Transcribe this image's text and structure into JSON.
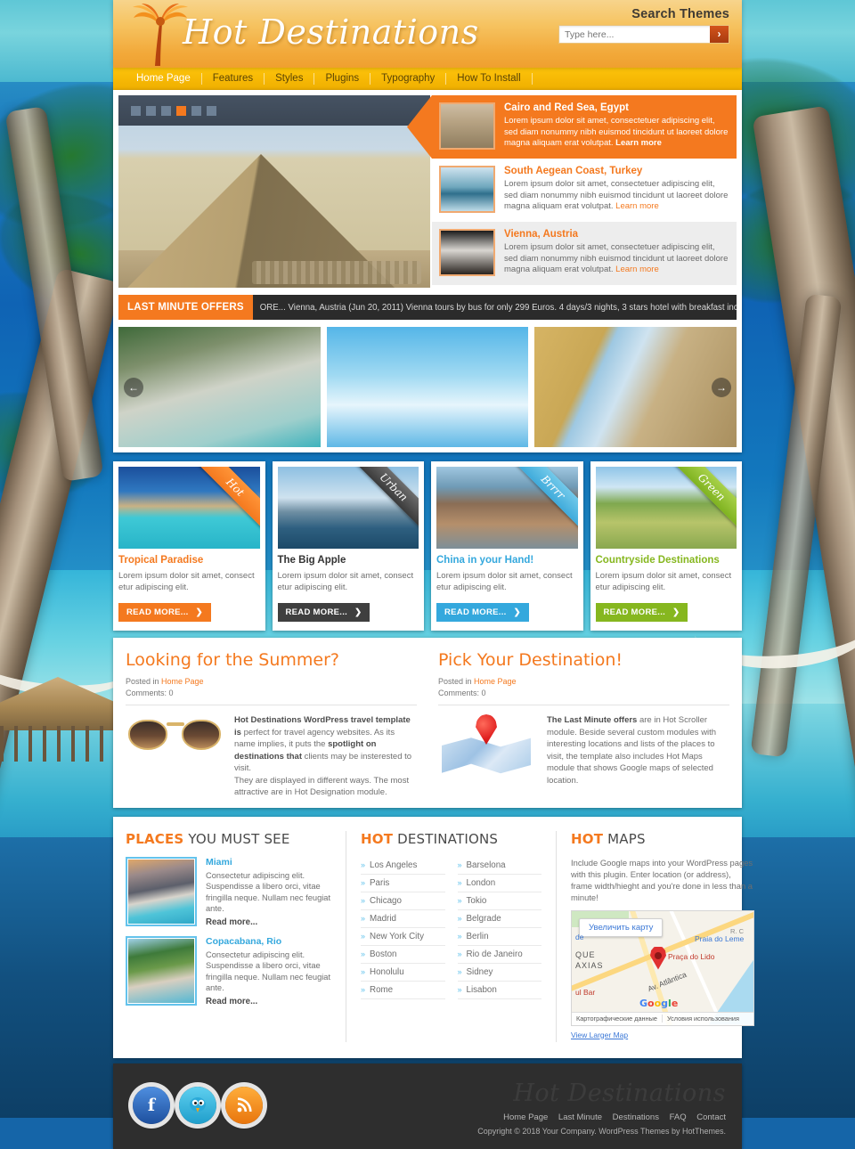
{
  "header": {
    "logo_text": "Hot Destinations",
    "palm_icon": "palm-tree-icon",
    "search_label": "Search Themes",
    "search_placeholder": "Type here...",
    "search_button_icon": "chevron-right-icon"
  },
  "nav": {
    "items": [
      {
        "label": "Home Page",
        "active": true
      },
      {
        "label": "Features",
        "active": false
      },
      {
        "label": "Styles",
        "active": false
      },
      {
        "label": "Plugins",
        "active": false
      },
      {
        "label": "Typography",
        "active": false
      },
      {
        "label": "How To Install",
        "active": false
      }
    ]
  },
  "slider": {
    "dots": [
      false,
      false,
      false,
      true,
      false,
      false
    ],
    "main_image_alt": "pyramid-of-giza-photo",
    "items": [
      {
        "title": "Cairo and Red Sea, Egypt",
        "desc": "Lorem ipsum dolor sit amet, consectetuer adipiscing elit, sed diam nonummy nibh euismod tincidunt ut laoreet dolore magna aliquam erat volutpat.",
        "more": "Learn more",
        "thumb": "egypt-temple-thumb"
      },
      {
        "title": "South Aegean Coast, Turkey",
        "desc": "Lorem ipsum dolor sit amet, consectetuer adipiscing elit, sed diam nonummy nibh euismod tincidunt ut laoreet dolore magna aliquam erat volutpat.",
        "more": "Learn more",
        "thumb": "aegean-beach-thumb"
      },
      {
        "title": "Vienna, Austria",
        "desc": "Lorem ipsum dolor sit amet, consectetuer adipiscing elit, sed diam nonummy nibh euismod tincidunt ut laoreet dolore magna aliquam erat volutpat.",
        "more": "Learn more",
        "thumb": "vienna-opera-thumb"
      }
    ]
  },
  "ticker": {
    "label": "LAST MINUTE OFFERS",
    "text": "ORE... Vienna, Austria (Jun 20, 2011) Vienna tours by bus for only 299 Euros. 4 days/3 nights, 3 stars hotel with breakfast included. Tour in Schoenbrunn incl."
  },
  "gallery": {
    "prev_icon": "arrow-left-icon",
    "next_icon": "arrow-right-icon",
    "images": [
      "rocky-coast-photo",
      "water-slide-photo",
      "stone-wall-photo"
    ]
  },
  "cards": [
    {
      "ribbon": "Hot",
      "title": "Tropical Paradise",
      "desc": "Lorem ipsum dolor sit amet, consect etur adipiscing elit.",
      "button": "READ MORE...",
      "button_icon": "chevron-right-icon",
      "color": "#f4791f"
    },
    {
      "ribbon": "Urban",
      "title": "The Big Apple",
      "desc": "Lorem ipsum dolor sit amet, consect etur adipiscing elit.",
      "button": "READ MORE...",
      "button_icon": "chevron-right-icon",
      "color": "#3f3f3f"
    },
    {
      "ribbon": "Brrrr",
      "title": "China in your Hand!",
      "desc": "Lorem ipsum dolor sit amet, consect etur adipiscing elit.",
      "button": "READ MORE...",
      "button_icon": "chevron-right-icon",
      "color": "#34a8dd"
    },
    {
      "ribbon": "Green",
      "title": "Countryside Destinations",
      "desc": "Lorem ipsum dolor sit amet, consect etur adipiscing elit.",
      "button": "READ MORE...",
      "button_icon": "chevron-right-icon",
      "color": "#86b71f"
    }
  ],
  "posts": [
    {
      "title": "Looking for the Summer?",
      "posted_in_label": "Posted in ",
      "category": "Home Page",
      "comments": "Comments: 0",
      "thumb": "sunglasses-icon",
      "body_bold_1": "Hot Destinations WordPress travel template is",
      "body_1": " perfect for travel agency websites. As its name implies, it puts the ",
      "body_bold_2": "spotlight on destinations that",
      "body_2": " clients may be insterested to visit.",
      "body_3": "They are displayed in different ways. The most attractive are in Hot Designation module."
    },
    {
      "title": "Pick Your Destination!",
      "posted_in_label": "Posted in ",
      "category": "Home Page",
      "comments": "Comments: 0",
      "thumb": "map-pin-icon",
      "body_bold_1": "The Last Minute offers",
      "body_1": " are in Hot Scroller module. Beside several custom modules with interesting locations and lists of the places to visit, the template also includes Hot Maps module that shows Google maps of selected location."
    }
  ],
  "widgets": {
    "places": {
      "title_accent": "PLACES",
      "title_rest": " YOU MUST SEE",
      "items": [
        {
          "name": "Miami",
          "desc": "Consectetur adipiscing elit. Suspendisse a libero orci, vitae fringilla neque. Nullam nec feugiat ante.",
          "more": "Read more...",
          "thumb": "miami-beach-thumb"
        },
        {
          "name": "Copacabana, Rio",
          "desc": "Consectetur adipiscing elit. Suspendisse a libero orci, vitae fringilla neque. Nullam nec feugiat ante.",
          "more": "Read more...",
          "thumb": "copacabana-thumb"
        }
      ]
    },
    "destinations": {
      "title_accent": "HOT",
      "title_rest": " DESTINATIONS",
      "col1": [
        "Los Angeles",
        "Paris",
        "Chicago",
        "Madrid",
        "New York City",
        "Boston",
        "Honolulu",
        "Rome"
      ],
      "col2": [
        "Barselona",
        "London",
        "Tokio",
        "Belgrade",
        "Berlin",
        "Rio de Janeiro",
        "Sidney",
        "Lisabon"
      ]
    },
    "maps": {
      "title_accent": "HOT",
      "title_rest": " MAPS",
      "text": "Include Google maps into your WordPress pages with this plugin. Enter location (or address), frame width/hieght and you're done in less than a minute!",
      "zoom_button": "Увеличить карту",
      "labels": {
        "lido": "Praça do Lido",
        "leme": "Praia do Leme",
        "que": "QUE",
        "axias": "AXIAS",
        "bar": "ul Bar",
        "de": "de",
        "atlantica": "Av. Atlântica",
        "rc": "R. C"
      },
      "brand": "Google",
      "footer_left": "Картографические данные",
      "footer_right": "Условия использования",
      "view_larger": "View Larger Map"
    }
  },
  "footer": {
    "social": [
      {
        "name": "facebook-icon",
        "glyph": "f"
      },
      {
        "name": "twitter-icon",
        "glyph": "t"
      },
      {
        "name": "rss-icon",
        "glyph": "≈"
      }
    ],
    "brand": "Hot Destinations",
    "links": [
      "Home Page",
      "Last Minute",
      "Destinations",
      "FAQ",
      "Contact"
    ],
    "copyright": "Copyright © 2018 Your Company. WordPress Themes by HotThemes."
  },
  "colors": {
    "accent_orange": "#f4791f",
    "nav_yellow": "#fcc30b",
    "blue": "#34a8dd",
    "green": "#86b71f",
    "dark": "#2e2e2e"
  }
}
